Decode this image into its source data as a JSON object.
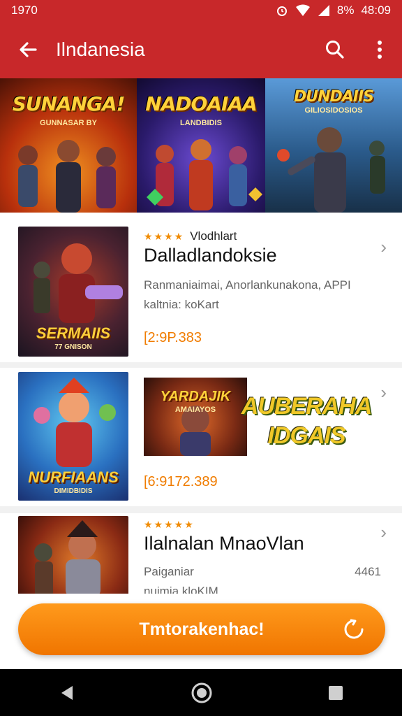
{
  "status": {
    "time_left": "1970",
    "battery": "8%",
    "clock": "48:09"
  },
  "appbar": {
    "title": "Ilndanesia"
  },
  "banner": [
    {
      "title": "SUNANGA!",
      "subtitle": "GUNNASAR BY",
      "colors": [
        "#d8451a",
        "#5a1a0a"
      ]
    },
    {
      "title": "NADOAIAA",
      "subtitle": "LANDBIDIS",
      "colors": [
        "#3a2a8c",
        "#1a0f3a"
      ]
    },
    {
      "title": "DUNDAIIS",
      "subtitle": "GILIOSIDOSIOS",
      "colors": [
        "#2e6aa8",
        "#14304f"
      ]
    }
  ],
  "items": [
    {
      "stars": "★★★★",
      "meta": "Vlodhlart",
      "name": "Dalladlandoksie",
      "desc_line1": "Ranmaniaimai, Anorlankunakona, APPI",
      "desc_line2": "kaltnia: koKart",
      "count": "[2:9P.383",
      "thumb_label": "SERMAIIS",
      "thumb_sub": "77 GNISON"
    },
    {
      "count": "[6:9172.389",
      "thumb_label": "NURFIAANS",
      "thumb_sub": "DIMIDBIDIS",
      "promo_small": "YARDAJIK",
      "promo_small_sub": "AMAIAYOS",
      "promo_big_line1": "AUBERAHA",
      "promo_big_line2": "IDGAIS"
    },
    {
      "stars": "★★★★★",
      "name": "Ilalnalan MnaoVlan",
      "desc_line1": "Paiganiar",
      "desc_line2": "nuimia kloKIM",
      "extra": "4461"
    }
  ],
  "cta": {
    "label": "Tmtorakenhac!"
  },
  "colors": {
    "appbar": "#c8282a",
    "accent": "#f07c00"
  },
  "icons": [
    "back-arrow-icon",
    "search-icon",
    "more-vert-icon",
    "chevron-right-icon",
    "recycle-icon",
    "nav-back-icon",
    "nav-home-icon",
    "nav-recents-icon"
  ]
}
